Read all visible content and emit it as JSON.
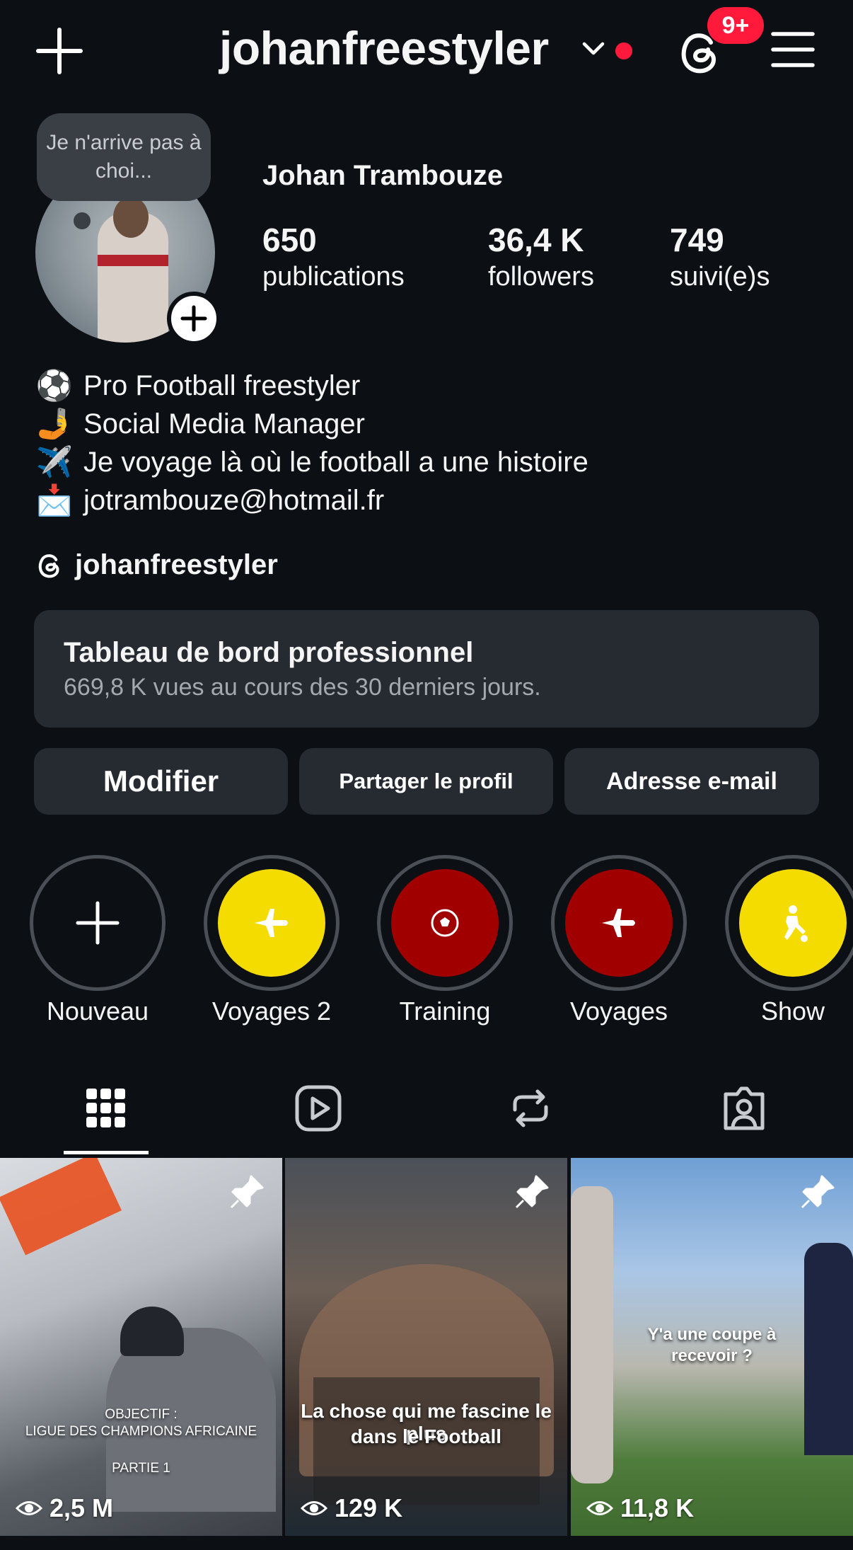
{
  "header": {
    "username": "johanfreestyler",
    "notification_badge": "9+"
  },
  "profile": {
    "note": "Je n'arrive pas à choi...",
    "name": "Johan Trambouze",
    "stats": [
      {
        "value": "650",
        "label": "publications"
      },
      {
        "value": "36,4 K",
        "label": "followers"
      },
      {
        "value": "749",
        "label": "suivi(e)s"
      }
    ],
    "bio": [
      {
        "emoji": "⚽",
        "text": "Pro Football freestyler"
      },
      {
        "emoji": "🤳",
        "text": "Social Media Manager"
      },
      {
        "emoji": "✈️",
        "text": "Je voyage là où le football a une histoire"
      },
      {
        "emoji": "📩",
        "text": "jotrambouze@hotmail.fr"
      }
    ],
    "threads_handle": "johanfreestyler"
  },
  "dashboard": {
    "title": "Tableau de bord professionnel",
    "subtitle": "669,8 K vues au cours des 30 derniers jours."
  },
  "buttons": {
    "edit": "Modifier",
    "share": "Partager le profil",
    "email": "Adresse e-mail"
  },
  "highlights": [
    {
      "label": "Nouveau",
      "icon": "plus-icon",
      "color": "#0c0f14"
    },
    {
      "label": "Voyages 2",
      "icon": "airplane-icon",
      "color": "#f5dc00"
    },
    {
      "label": "Training",
      "icon": "soccer-ball-icon",
      "color": "#a00000"
    },
    {
      "label": "Voyages",
      "icon": "airplane-icon",
      "color": "#a00000"
    },
    {
      "label": "Show",
      "icon": "kicking-player-icon",
      "color": "#f5dc00"
    }
  ],
  "tabs": [
    "grid-icon",
    "reels-icon",
    "reposts-icon",
    "tagged-icon"
  ],
  "posts": [
    {
      "views": "2,5 M",
      "caption": [
        "OBJECTIF :",
        "LIGUE DES CHAMPIONS AFRICAINE",
        "PARTIE 1"
      ],
      "pinned": true
    },
    {
      "views": "129 K",
      "caption": [
        "La chose qui me fascine le plus",
        "dans le Football"
      ],
      "pinned": true
    },
    {
      "views": "11,8 K",
      "caption": [
        "Y'a une coupe à",
        "recevoir ?"
      ],
      "pinned": true
    }
  ]
}
